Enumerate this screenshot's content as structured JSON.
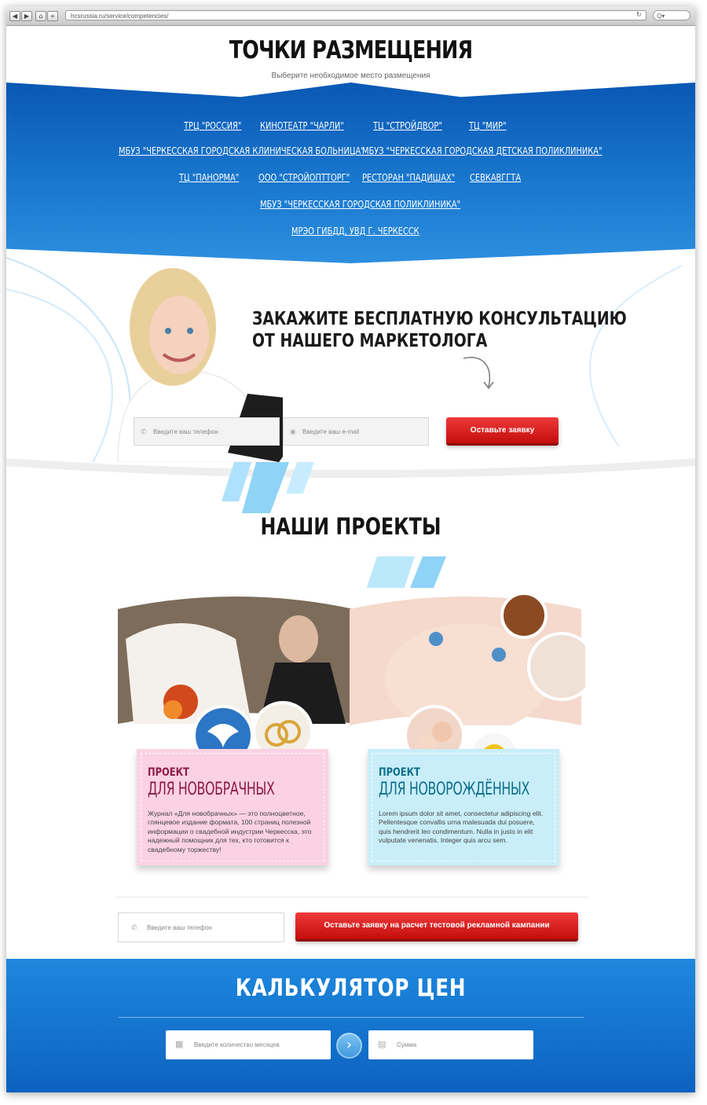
{
  "browser": {
    "url": "hcsrussia.ru/service/competencies/",
    "nav_icons": [
      "back-icon",
      "forward-icon",
      "home-icon",
      "add-tab-icon"
    ]
  },
  "header": {
    "title": "ТОЧКИ РАЗМЕЩЕНИЯ",
    "subtitle": "Выберите необходимое место размещения"
  },
  "locations": [
    "ТРЦ \"РОССИЯ\"",
    "КИНОТЕАТР \"ЧАРЛИ\"",
    "ТЦ \"СТРОЙДВОР\"",
    "ТЦ \"МИР\"",
    "МБУЗ \"ЧЕРКЕССКАЯ ГОРОДСКАЯ КЛИНИЧЕСКАЯ БОЛЬНИЦА\"",
    "МБУЗ \"ЧЕРКЕССКАЯ ГОРОДСКАЯ ДЕТСКАЯ ПОЛИКЛИНИКА\"",
    "ТЦ \"ПАНОРМА\"",
    "ООО \"СТРОЙОПТТОРГ\"",
    "РЕСТОРАН \"ПАДИШАХ\"",
    "СЕВКАВГГТА",
    "МБУЗ \"ЧЕРКЕССКАЯ ГОРОДСКАЯ ПОЛИКЛИНИКА\"",
    "МРЭО ГИБДД, УВД Г. ЧЕРКЕССК"
  ],
  "consult": {
    "line1": "ЗАКАЖИТЕ БЕСПЛАТНУЮ КОНСУЛЬТАЦИЮ",
    "line2": "ОТ НАШЕГО МАРКЕТОЛОГА",
    "phone_placeholder": "Введите ваш телефон",
    "email_placeholder": "Введите ваш e-mail",
    "button": "Оставьте заявку"
  },
  "projects": {
    "title": "НАШИ ПРОЕКТЫ",
    "cards": [
      {
        "kicker": "ПРОЕКТ",
        "title": "ДЛЯ НОВОБРАЧНЫХ",
        "text": "Журнал «Для новобрачных» — это полноцветное, глянцевое издание формата, 100 страниц полезной информации о свадебной индустрии Черкесска, это надежный помощник для тех, кто готовится к свадебному торжеству!",
        "color": "#fbd2e4",
        "accent": "#8c1b47"
      },
      {
        "kicker": "ПРОЕКТ",
        "title": "ДЛЯ НОВОРОЖДЁННЫХ",
        "text": "Lorem ipsum dolor sit amet, consectetur adipiscing elit. Pellentesque convallis urna malesuada dui posuere, quis hendrerit leo condimentum. Nulla in justo in elit vulputate venenatis. Integer quis arcu sem.",
        "color": "#c9eef9",
        "accent": "#0d6f8b"
      }
    ]
  },
  "test_request": {
    "phone_placeholder": "Введите ваш телефон",
    "button": "Оставьте заявку на расчет тестовой рекламной кампании"
  },
  "calculator": {
    "title": "КАЛЬКУЛЯТОР ЦЕН",
    "months_placeholder": "Введите количество месяцев",
    "sum_placeholder": "Сумма"
  }
}
